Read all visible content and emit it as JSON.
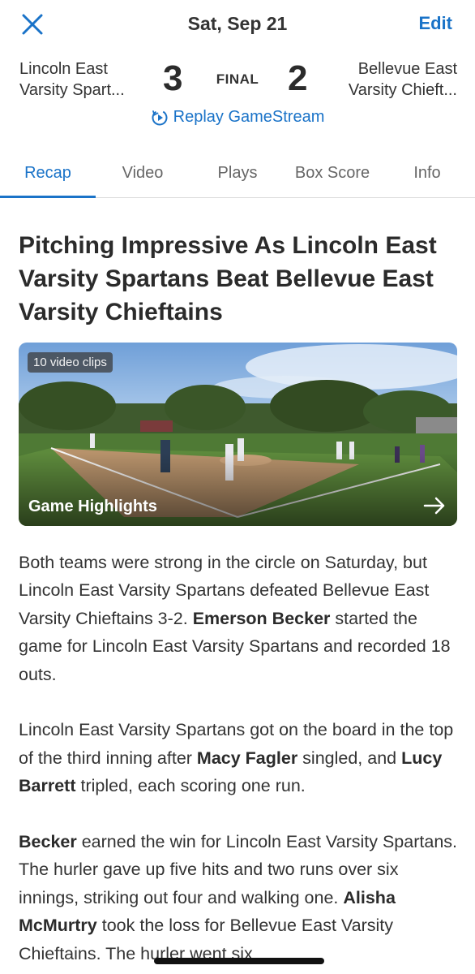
{
  "nav": {
    "title": "Sat, Sep 21",
    "edit_label": "Edit",
    "close_icon": "close-icon"
  },
  "game": {
    "home": {
      "line1": "Lincoln East",
      "line2": "Varsity Spart...",
      "score": "3"
    },
    "away": {
      "line1": "Bellevue East",
      "line2": "Varsity Chieft...",
      "score": "2"
    },
    "status": "FINAL",
    "replay_label": "Replay GameStream"
  },
  "tabs": [
    {
      "label": "Recap",
      "active": true
    },
    {
      "label": "Video",
      "active": false
    },
    {
      "label": "Plays",
      "active": false
    },
    {
      "label": "Box Score",
      "active": false
    },
    {
      "label": "Info",
      "active": false
    }
  ],
  "article": {
    "headline": "Pitching Impressive As Lincoln East Varsity Spartans Beat Bellevue East Varsity Chieftains",
    "video": {
      "badge": "10 video clips",
      "title": "Game Highlights"
    },
    "paragraphs": [
      {
        "p1": "Both teams were strong in the circle on Saturday, but Lincoln East Varsity Spartans defeated Bellevue East Varsity Chieftains 3-2. ",
        "b1": "Emerson Becker",
        "p2": " started the game for Lincoln East Varsity Spartans and recorded 18 outs."
      },
      {
        "p1": "Lincoln East Varsity Spartans got on the board in the top of the third inning after ",
        "b1": "Macy Fagler",
        "p2": " singled, and ",
        "b2": "Lucy Barrett",
        "p3": " tripled, each scoring one run."
      },
      {
        "b1": "Becker",
        "p1": " earned the win for Lincoln East Varsity Spartans. The hurler gave up five hits and two runs over six innings, striking out four and walking one. ",
        "b2": "Alisha McMurtry",
        "p2": " took the loss for Bellevue East Varsity Chieftains. The hurler went six"
      }
    ]
  },
  "colors": {
    "accent": "#1a73c8",
    "text": "#2b2b2b"
  }
}
